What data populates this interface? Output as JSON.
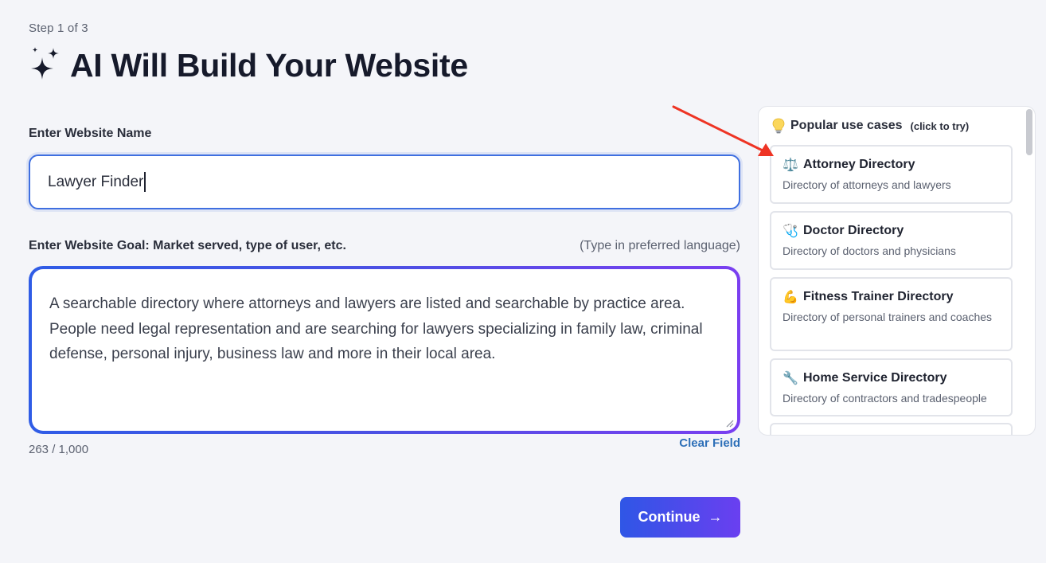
{
  "header": {
    "step": "Step 1 of 3",
    "title": "AI Will Build Your Website",
    "icon": "sparkles-icon"
  },
  "form": {
    "name_label": "Enter Website Name",
    "name_value": "Lawyer Finder",
    "goal_label": "Enter Website Goal: Market served, type of user, etc.",
    "goal_hint": "(Type in preferred language)",
    "goal_value": "A searchable directory where attorneys and lawyers are listed and searchable by practice area. People need legal representation and are searching for lawyers specializing in family law, criminal defense, personal injury, business law and more in their local area.",
    "char_count": "263 / 1,000",
    "clear_label": "Clear Field",
    "continue_label": "Continue",
    "continue_arrow": "→"
  },
  "use_cases": {
    "title": "Popular use cases",
    "subtitle": "(click to try)",
    "items": [
      {
        "emoji": "⚖️",
        "icon": "scales-icon",
        "title": "Attorney Directory",
        "desc": "Directory of attorneys and lawyers"
      },
      {
        "emoji": "🩺",
        "icon": "stethoscope-icon",
        "title": "Doctor Directory",
        "desc": "Directory of doctors and physicians"
      },
      {
        "emoji": "💪",
        "icon": "flexed-bicep-icon",
        "title": "Fitness Trainer Directory",
        "desc": "Directory of personal trainers and coaches"
      },
      {
        "emoji": "🔧",
        "icon": "wrench-icon",
        "title": "Home Service Directory",
        "desc": "Directory of contractors and tradespeople"
      }
    ]
  },
  "colors": {
    "accent": "#3f6fe0",
    "gradient_start": "#2f56e6",
    "gradient_end": "#7a3ff0",
    "annotation_arrow": "#ee3424"
  }
}
